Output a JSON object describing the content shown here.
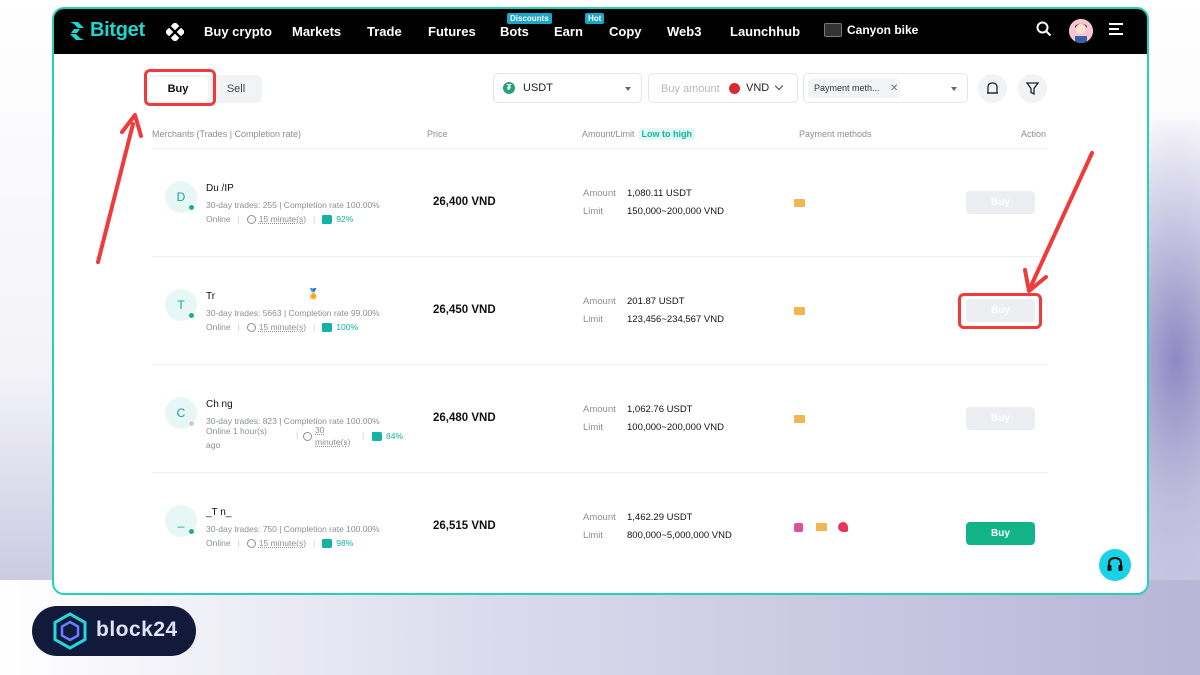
{
  "nav": {
    "logo_text": "Bitget",
    "items": [
      {
        "label": "Buy crypto"
      },
      {
        "label": "Markets"
      },
      {
        "label": "Trade"
      },
      {
        "label": "Futures"
      },
      {
        "label": "Bots",
        "badge": "Discounts"
      },
      {
        "label": "Earn",
        "badge": "Hot"
      },
      {
        "label": "Copy"
      },
      {
        "label": "Web3"
      },
      {
        "label": "Launchhub"
      }
    ],
    "promo_label": "Canyon bike"
  },
  "toolbar": {
    "tab_buy": "Buy",
    "tab_sell": "Sell",
    "coin_select": "USDT",
    "amount_placeholder": "Buy amount",
    "currency": "VND",
    "payment_chip": "Payment meth..."
  },
  "table": {
    "headers": {
      "merchant": "Merchants (Trades | Completion rate)",
      "price": "Price",
      "amount": "Amount/Limit",
      "sort_badge": "Low to high",
      "payment": "Payment methods",
      "action": "Action"
    },
    "amount_label": "Amount",
    "limit_label": "Limit",
    "rows": [
      {
        "initial": "D",
        "name": "Du            /IP",
        "stats": "30-day trades: 255 | Completion rate 100.00%",
        "status": "Online",
        "time": "15 minute(s)",
        "rating": "92%",
        "price": "26,400 VND",
        "amount": "1,080.11 USDT",
        "limit": "150,000~200,000 VND",
        "action": "Buy"
      },
      {
        "initial": "T",
        "name": "Tr",
        "stats": "30-day trades: 5663 | Completion rate 99.00%",
        "status": "Online",
        "time": "15 minute(s)",
        "rating": "100%",
        "price": "26,450 VND",
        "amount": "201.87 USDT",
        "limit": "123,456~234,567 VND",
        "action": "Buy"
      },
      {
        "initial": "C",
        "name": "Ch            ng",
        "stats": "30-day trades: 823 | Completion rate 100.00%",
        "status": "Online 1 hour(s)",
        "status_2": "ago",
        "time": "30",
        "time_2": "minute(s)",
        "rating": "84%",
        "price": "26,480 VND",
        "amount": "1,062.76 USDT",
        "limit": "100,000~200,000 VND",
        "action": "Buy"
      },
      {
        "initial": "_",
        "name": "_T  n_",
        "stats": "30-day trades: 750 | Completion rate 100.00%",
        "status": "Online",
        "time": "15 minute(s)",
        "rating": "98%",
        "price": "26,515 VND",
        "amount": "1,462.29 USDT",
        "limit": "800,000~5,000,000 VND",
        "action": "Buy"
      }
    ]
  },
  "watermark": "block24",
  "colors": {
    "accent": "#12b487",
    "frame": "#24d1b6",
    "annotation": "#ee3b3b",
    "nav_bg": "#000000"
  }
}
